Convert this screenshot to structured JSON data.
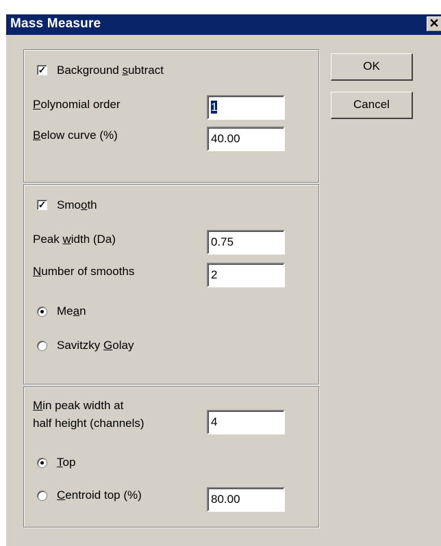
{
  "window": {
    "title": "Mass Measure",
    "close_glyph": "✕"
  },
  "buttons": {
    "ok": "OK",
    "cancel": "Cancel"
  },
  "background": {
    "checkbox_label_pre": "Background ",
    "checkbox_label_u": "s",
    "checkbox_label_post": "ubtract",
    "checked": true,
    "poly_label_u": "P",
    "poly_label_rest": "olynomial order",
    "poly_value": "1",
    "below_label_u": "B",
    "below_label_rest": "elow curve (%)",
    "below_value": "40.00"
  },
  "smooth": {
    "checkbox_label_pre": "Smo",
    "checkbox_label_u": "o",
    "checkbox_label_post": "th",
    "checked": true,
    "peak_label_pre": "Peak ",
    "peak_label_u": "w",
    "peak_label_post": "idth (Da)",
    "peak_value": "0.75",
    "num_label_u": "N",
    "num_label_rest": "umber of smooths",
    "num_value": "2",
    "mean_label_pre": "Me",
    "mean_label_u": "a",
    "mean_label_post": "n",
    "mean_selected": true,
    "sg_label_pre": "Savitzky ",
    "sg_label_u": "G",
    "sg_label_post": "olay",
    "sg_selected": false
  },
  "peak": {
    "min_label_u": "M",
    "min_label_line1_rest": "in peak width at",
    "min_label_line2": "half height (channels)",
    "min_value": "4",
    "top_label_u": "T",
    "top_label_rest": "op",
    "top_selected": true,
    "centroid_label_u": "C",
    "centroid_label_rest": "entroid top (%)",
    "centroid_selected": false,
    "centroid_value": "80.00"
  }
}
